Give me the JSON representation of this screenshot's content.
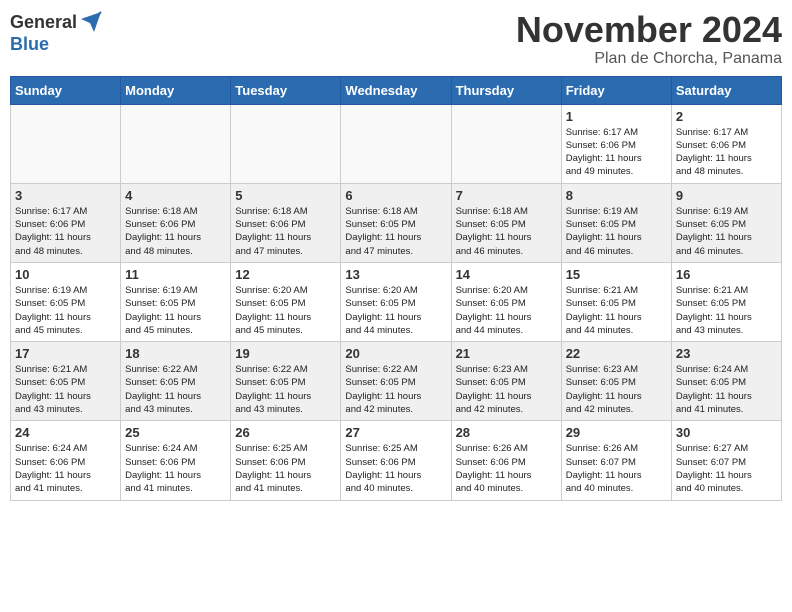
{
  "logo": {
    "general": "General",
    "blue": "Blue"
  },
  "title": "November 2024",
  "subtitle": "Plan de Chorcha, Panama",
  "weekdays": [
    "Sunday",
    "Monday",
    "Tuesday",
    "Wednesday",
    "Thursday",
    "Friday",
    "Saturday"
  ],
  "weeks": [
    [
      {
        "day": "",
        "info": ""
      },
      {
        "day": "",
        "info": ""
      },
      {
        "day": "",
        "info": ""
      },
      {
        "day": "",
        "info": ""
      },
      {
        "day": "",
        "info": ""
      },
      {
        "day": "1",
        "info": "Sunrise: 6:17 AM\nSunset: 6:06 PM\nDaylight: 11 hours\nand 49 minutes."
      },
      {
        "day": "2",
        "info": "Sunrise: 6:17 AM\nSunset: 6:06 PM\nDaylight: 11 hours\nand 48 minutes."
      }
    ],
    [
      {
        "day": "3",
        "info": "Sunrise: 6:17 AM\nSunset: 6:06 PM\nDaylight: 11 hours\nand 48 minutes."
      },
      {
        "day": "4",
        "info": "Sunrise: 6:18 AM\nSunset: 6:06 PM\nDaylight: 11 hours\nand 48 minutes."
      },
      {
        "day": "5",
        "info": "Sunrise: 6:18 AM\nSunset: 6:06 PM\nDaylight: 11 hours\nand 47 minutes."
      },
      {
        "day": "6",
        "info": "Sunrise: 6:18 AM\nSunset: 6:05 PM\nDaylight: 11 hours\nand 47 minutes."
      },
      {
        "day": "7",
        "info": "Sunrise: 6:18 AM\nSunset: 6:05 PM\nDaylight: 11 hours\nand 46 minutes."
      },
      {
        "day": "8",
        "info": "Sunrise: 6:19 AM\nSunset: 6:05 PM\nDaylight: 11 hours\nand 46 minutes."
      },
      {
        "day": "9",
        "info": "Sunrise: 6:19 AM\nSunset: 6:05 PM\nDaylight: 11 hours\nand 46 minutes."
      }
    ],
    [
      {
        "day": "10",
        "info": "Sunrise: 6:19 AM\nSunset: 6:05 PM\nDaylight: 11 hours\nand 45 minutes."
      },
      {
        "day": "11",
        "info": "Sunrise: 6:19 AM\nSunset: 6:05 PM\nDaylight: 11 hours\nand 45 minutes."
      },
      {
        "day": "12",
        "info": "Sunrise: 6:20 AM\nSunset: 6:05 PM\nDaylight: 11 hours\nand 45 minutes."
      },
      {
        "day": "13",
        "info": "Sunrise: 6:20 AM\nSunset: 6:05 PM\nDaylight: 11 hours\nand 44 minutes."
      },
      {
        "day": "14",
        "info": "Sunrise: 6:20 AM\nSunset: 6:05 PM\nDaylight: 11 hours\nand 44 minutes."
      },
      {
        "day": "15",
        "info": "Sunrise: 6:21 AM\nSunset: 6:05 PM\nDaylight: 11 hours\nand 44 minutes."
      },
      {
        "day": "16",
        "info": "Sunrise: 6:21 AM\nSunset: 6:05 PM\nDaylight: 11 hours\nand 43 minutes."
      }
    ],
    [
      {
        "day": "17",
        "info": "Sunrise: 6:21 AM\nSunset: 6:05 PM\nDaylight: 11 hours\nand 43 minutes."
      },
      {
        "day": "18",
        "info": "Sunrise: 6:22 AM\nSunset: 6:05 PM\nDaylight: 11 hours\nand 43 minutes."
      },
      {
        "day": "19",
        "info": "Sunrise: 6:22 AM\nSunset: 6:05 PM\nDaylight: 11 hours\nand 43 minutes."
      },
      {
        "day": "20",
        "info": "Sunrise: 6:22 AM\nSunset: 6:05 PM\nDaylight: 11 hours\nand 42 minutes."
      },
      {
        "day": "21",
        "info": "Sunrise: 6:23 AM\nSunset: 6:05 PM\nDaylight: 11 hours\nand 42 minutes."
      },
      {
        "day": "22",
        "info": "Sunrise: 6:23 AM\nSunset: 6:05 PM\nDaylight: 11 hours\nand 42 minutes."
      },
      {
        "day": "23",
        "info": "Sunrise: 6:24 AM\nSunset: 6:05 PM\nDaylight: 11 hours\nand 41 minutes."
      }
    ],
    [
      {
        "day": "24",
        "info": "Sunrise: 6:24 AM\nSunset: 6:06 PM\nDaylight: 11 hours\nand 41 minutes."
      },
      {
        "day": "25",
        "info": "Sunrise: 6:24 AM\nSunset: 6:06 PM\nDaylight: 11 hours\nand 41 minutes."
      },
      {
        "day": "26",
        "info": "Sunrise: 6:25 AM\nSunset: 6:06 PM\nDaylight: 11 hours\nand 41 minutes."
      },
      {
        "day": "27",
        "info": "Sunrise: 6:25 AM\nSunset: 6:06 PM\nDaylight: 11 hours\nand 40 minutes."
      },
      {
        "day": "28",
        "info": "Sunrise: 6:26 AM\nSunset: 6:06 PM\nDaylight: 11 hours\nand 40 minutes."
      },
      {
        "day": "29",
        "info": "Sunrise: 6:26 AM\nSunset: 6:07 PM\nDaylight: 11 hours\nand 40 minutes."
      },
      {
        "day": "30",
        "info": "Sunrise: 6:27 AM\nSunset: 6:07 PM\nDaylight: 11 hours\nand 40 minutes."
      }
    ]
  ]
}
